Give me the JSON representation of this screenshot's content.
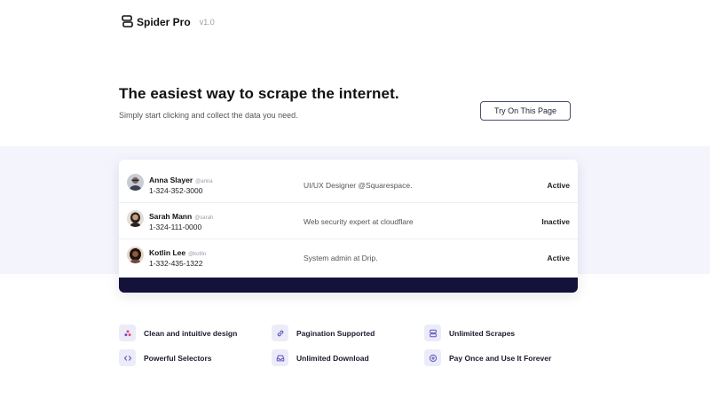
{
  "brand": {
    "name": "Spider Pro",
    "version": "v1.0"
  },
  "hero": {
    "title": "The easiest way to scrape the internet.",
    "subtitle": "Simply start clicking and collect the data you need.",
    "cta_label": "Try On This Page"
  },
  "people": [
    {
      "name": "Anna Slayer",
      "handle": "@anna",
      "phone": "1-324-352-3000",
      "bio": "UI/UX Designer @Squarespace.",
      "status": "Active"
    },
    {
      "name": "Sarah Mann",
      "handle": "@sarah",
      "phone": "1-324-111-0000",
      "bio": "Web security expert at cloudflare",
      "status": "Inactive"
    },
    {
      "name": "Kotlin Lee",
      "handle": "@kotlin",
      "phone": "1-332-435-1322",
      "bio": "System admin at Drip.",
      "status": "Active"
    }
  ],
  "features": [
    {
      "label": "Clean and intuitive design",
      "icon": "dots-icon"
    },
    {
      "label": "Pagination Supported",
      "icon": "link-icon"
    },
    {
      "label": "Unlimited Scrapes",
      "icon": "stack-icon"
    },
    {
      "label": "Powerful Selectors",
      "icon": "code-icon"
    },
    {
      "label": "Unlimited Download",
      "icon": "inbox-icon"
    },
    {
      "label": "Pay Once and Use It Forever",
      "icon": "plus-circle-icon"
    }
  ],
  "colors": {
    "accent": "#5b54c8",
    "dark_bar": "#14123a",
    "band": "#f3f4fc"
  }
}
